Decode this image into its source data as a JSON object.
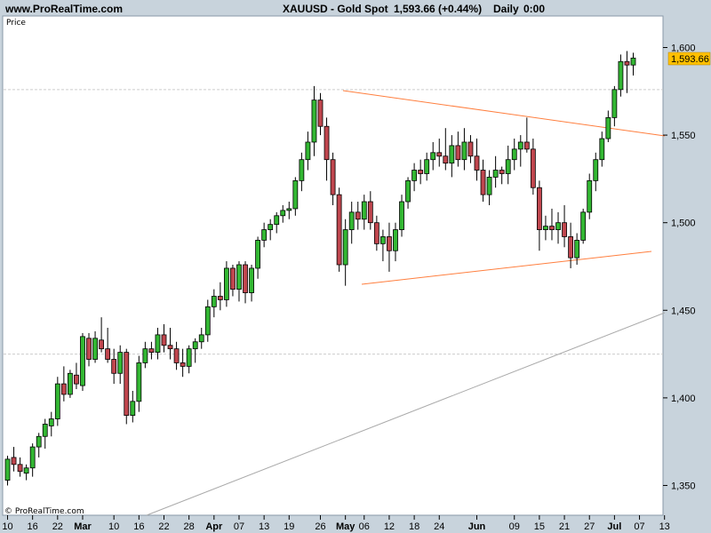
{
  "header": {
    "site": "www.ProRealTime.com",
    "symbol": "XAUUSD - Gold Spot",
    "quote": "1,593.66 (+0.44%)",
    "period": "Daily",
    "time": "0:00"
  },
  "panel_label": "Price",
  "copyright": "© ProRealTime.com",
  "colors": {
    "up": "#33b733",
    "down": "#c0464e",
    "trendline": "#ff7f3f",
    "support": "#aaaaaa",
    "badge": "#ffc000",
    "background": "#c8d3dc",
    "plot": "#ffffff"
  },
  "chart_data": {
    "type": "candlestick",
    "title": "XAUUSD - Gold Spot",
    "ylabel": "Price",
    "ylim": [
      1333,
      1618
    ],
    "y_ticks": [
      "1,600",
      "1,550",
      "1,500",
      "1,450",
      "1,400",
      "1,350"
    ],
    "x_ticks": [
      {
        "label": "10",
        "i": 0
      },
      {
        "label": "16",
        "i": 4
      },
      {
        "label": "22",
        "i": 8
      },
      {
        "label": "Mar",
        "i": 12,
        "bold": true
      },
      {
        "label": "10",
        "i": 17
      },
      {
        "label": "16",
        "i": 21
      },
      {
        "label": "22",
        "i": 25
      },
      {
        "label": "28",
        "i": 29
      },
      {
        "label": "Apr",
        "i": 33,
        "bold": true
      },
      {
        "label": "07",
        "i": 37
      },
      {
        "label": "13",
        "i": 41
      },
      {
        "label": "19",
        "i": 45
      },
      {
        "label": "26",
        "i": 50
      },
      {
        "label": "May",
        "i": 54,
        "bold": true
      },
      {
        "label": "06",
        "i": 57
      },
      {
        "label": "12",
        "i": 61
      },
      {
        "label": "18",
        "i": 65
      },
      {
        "label": "24",
        "i": 69
      },
      {
        "label": "Jun",
        "i": 75,
        "bold": true
      },
      {
        "label": "09",
        "i": 81
      },
      {
        "label": "15",
        "i": 85
      },
      {
        "label": "21",
        "i": 89
      },
      {
        "label": "27",
        "i": 93
      },
      {
        "label": "Jul",
        "i": 97,
        "bold": true
      },
      {
        "label": "07",
        "i": 101
      },
      {
        "label": "13",
        "i": 105
      }
    ],
    "last_price": "1,593.66",
    "reference_levels": [
      1576,
      1425
    ],
    "ohlc": [
      [
        1353,
        1367,
        1350,
        1365
      ],
      [
        1366,
        1372,
        1358,
        1362
      ],
      [
        1362,
        1366,
        1355,
        1358
      ],
      [
        1357,
        1362,
        1353,
        1360
      ],
      [
        1360,
        1374,
        1355,
        1372
      ],
      [
        1372,
        1380,
        1366,
        1378
      ],
      [
        1378,
        1388,
        1371,
        1385
      ],
      [
        1384,
        1392,
        1378,
        1388
      ],
      [
        1388,
        1412,
        1384,
        1408
      ],
      [
        1408,
        1418,
        1398,
        1402
      ],
      [
        1402,
        1416,
        1400,
        1414
      ],
      [
        1413,
        1420,
        1405,
        1408
      ],
      [
        1407,
        1437,
        1404,
        1435
      ],
      [
        1434,
        1437,
        1418,
        1422
      ],
      [
        1422,
        1438,
        1420,
        1434
      ],
      [
        1433,
        1446,
        1426,
        1428
      ],
      [
        1428,
        1440,
        1420,
        1422
      ],
      [
        1422,
        1428,
        1408,
        1414
      ],
      [
        1414,
        1430,
        1408,
        1426
      ],
      [
        1426,
        1428,
        1385,
        1390
      ],
      [
        1390,
        1404,
        1386,
        1398
      ],
      [
        1398,
        1424,
        1392,
        1420
      ],
      [
        1420,
        1432,
        1417,
        1428
      ],
      [
        1428,
        1432,
        1422,
        1426
      ],
      [
        1426,
        1440,
        1422,
        1436
      ],
      [
        1436,
        1442,
        1426,
        1430
      ],
      [
        1430,
        1440,
        1422,
        1428
      ],
      [
        1428,
        1432,
        1416,
        1420
      ],
      [
        1420,
        1428,
        1412,
        1418
      ],
      [
        1418,
        1430,
        1414,
        1428
      ],
      [
        1428,
        1434,
        1420,
        1432
      ],
      [
        1432,
        1440,
        1428,
        1436
      ],
      [
        1436,
        1456,
        1432,
        1452
      ],
      [
        1452,
        1462,
        1446,
        1458
      ],
      [
        1458,
        1466,
        1450,
        1456
      ],
      [
        1456,
        1478,
        1452,
        1474
      ],
      [
        1474,
        1476,
        1458,
        1462
      ],
      [
        1462,
        1478,
        1455,
        1476
      ],
      [
        1476,
        1478,
        1454,
        1460
      ],
      [
        1460,
        1476,
        1455,
        1474
      ],
      [
        1474,
        1492,
        1468,
        1490
      ],
      [
        1490,
        1500,
        1486,
        1496
      ],
      [
        1496,
        1502,
        1490,
        1499
      ],
      [
        1499,
        1506,
        1494,
        1504
      ],
      [
        1504,
        1510,
        1500,
        1507
      ],
      [
        1507,
        1512,
        1502,
        1508
      ],
      [
        1508,
        1526,
        1504,
        1524
      ],
      [
        1524,
        1540,
        1518,
        1536
      ],
      [
        1536,
        1552,
        1530,
        1546
      ],
      [
        1546,
        1578,
        1538,
        1570
      ],
      [
        1570,
        1574,
        1550,
        1555
      ],
      [
        1555,
        1560,
        1524,
        1536
      ],
      [
        1536,
        1540,
        1510,
        1516
      ],
      [
        1516,
        1520,
        1472,
        1476
      ],
      [
        1476,
        1502,
        1464,
        1496
      ],
      [
        1496,
        1512,
        1488,
        1506
      ],
      [
        1506,
        1512,
        1496,
        1502
      ],
      [
        1502,
        1516,
        1496,
        1512
      ],
      [
        1512,
        1518,
        1496,
        1500
      ],
      [
        1500,
        1504,
        1484,
        1488
      ],
      [
        1488,
        1496,
        1478,
        1492
      ],
      [
        1492,
        1500,
        1472,
        1484
      ],
      [
        1484,
        1500,
        1478,
        1496
      ],
      [
        1496,
        1516,
        1492,
        1512
      ],
      [
        1512,
        1526,
        1508,
        1524
      ],
      [
        1524,
        1534,
        1518,
        1530
      ],
      [
        1530,
        1536,
        1522,
        1528
      ],
      [
        1528,
        1540,
        1524,
        1536
      ],
      [
        1536,
        1546,
        1530,
        1540
      ],
      [
        1540,
        1548,
        1532,
        1538
      ],
      [
        1538,
        1554,
        1530,
        1534
      ],
      [
        1534,
        1550,
        1526,
        1544
      ],
      [
        1544,
        1552,
        1532,
        1536
      ],
      [
        1536,
        1554,
        1530,
        1546
      ],
      [
        1546,
        1550,
        1534,
        1538
      ],
      [
        1538,
        1548,
        1524,
        1530
      ],
      [
        1530,
        1536,
        1512,
        1516
      ],
      [
        1516,
        1530,
        1510,
        1526
      ],
      [
        1526,
        1538,
        1520,
        1530
      ],
      [
        1530,
        1532,
        1522,
        1528
      ],
      [
        1528,
        1544,
        1522,
        1536
      ],
      [
        1536,
        1548,
        1530,
        1542
      ],
      [
        1542,
        1550,
        1532,
        1546
      ],
      [
        1546,
        1560,
        1540,
        1542
      ],
      [
        1542,
        1548,
        1516,
        1520
      ],
      [
        1520,
        1524,
        1484,
        1496
      ],
      [
        1496,
        1504,
        1490,
        1498
      ],
      [
        1498,
        1508,
        1490,
        1496
      ],
      [
        1496,
        1506,
        1488,
        1500
      ],
      [
        1500,
        1510,
        1486,
        1492
      ],
      [
        1492,
        1500,
        1474,
        1480
      ],
      [
        1480,
        1494,
        1476,
        1490
      ],
      [
        1490,
        1508,
        1488,
        1506
      ],
      [
        1506,
        1528,
        1502,
        1524
      ],
      [
        1524,
        1540,
        1518,
        1536
      ],
      [
        1536,
        1552,
        1532,
        1548
      ],
      [
        1548,
        1564,
        1546,
        1560
      ],
      [
        1560,
        1578,
        1555,
        1576
      ],
      [
        1576,
        1596,
        1572,
        1592
      ],
      [
        1592,
        1598,
        1574,
        1590
      ],
      [
        1590,
        1597,
        1584,
        1594
      ]
    ]
  }
}
